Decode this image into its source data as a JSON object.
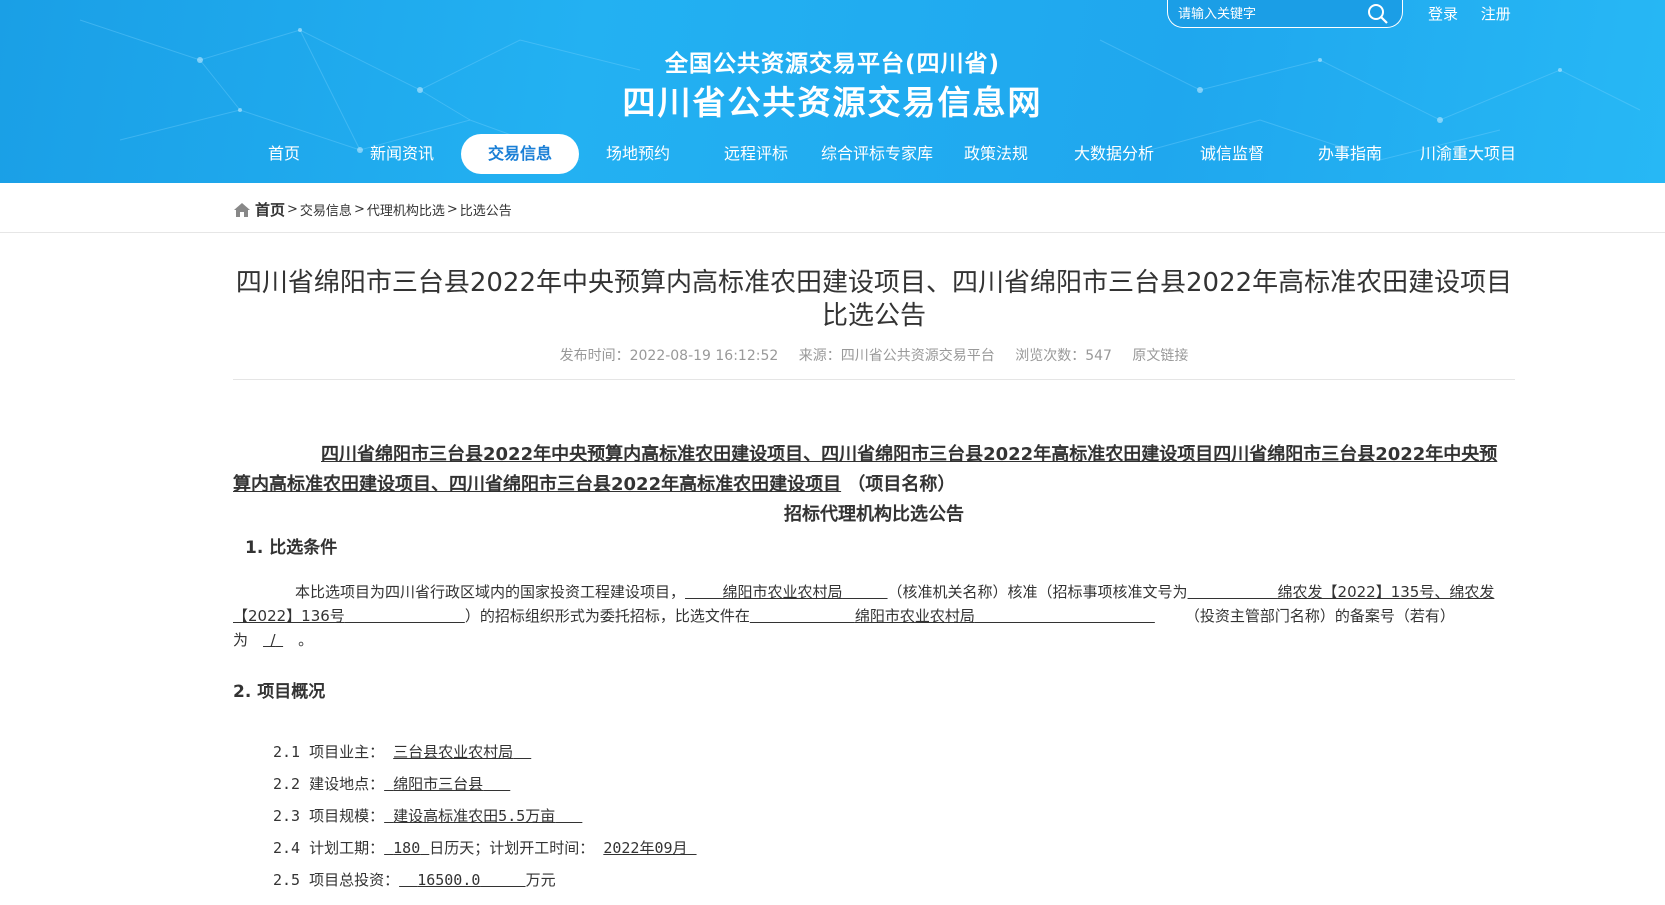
{
  "header": {
    "search_placeholder": "请输入关键字",
    "login": "登录",
    "register": "注册",
    "title1": "全国公共资源交易平台(四川省)",
    "title2": "四川省公共资源交易信息网",
    "nav": [
      "首页",
      "新闻资讯",
      "交易信息",
      "场地预约",
      "远程评标",
      "综合评标专家库",
      "政策法规",
      "大数据分析",
      "诚信监督",
      "办事指南",
      "川渝重大项目"
    ]
  },
  "breadcrumb": {
    "home": "首页",
    "sep": ">",
    "items": [
      "交易信息",
      "代理机构比选",
      "比选公告"
    ]
  },
  "article": {
    "title": "四川省绵阳市三台县2022年中央预算内高标准农田建设项目、四川省绵阳市三台县2022年高标准农田建设项目比选公告",
    "meta": {
      "publish": "发布时间：2022-08-19 16:12:52",
      "source": "来源：四川省公共资源交易平台",
      "views": "浏览次数：547",
      "link": "原文链接"
    },
    "project_heading": "四川省绵阳市三台县2022年中央预算内高标准农田建设项目、四川省绵阳市三台县2022年高标准农田建设项目四川省绵阳市三台县2022年中央预算内高标准农田建设项目、四川省绵阳市三台县2022年高标准农田建设项目",
    "project_suffix": "（项目名称）",
    "subheading": "招标代理机构比选公告",
    "sec1": "1.  比选条件",
    "para1_a": "本比选项目为四川省行政区域内的国家投资工程建设项目，",
    "para1_b": "绵阳市农业农村局",
    "para1_c": "（核准机关名称）核准（招标事项核准文号为",
    "para1_d": "绵农发【2022】135号、绵农发【2022】136号",
    "para1_e": "）的招标组织形式为委托招标，比选文件在",
    "para1_f": "绵阳市农业农村局",
    "para1_g": "（投资主管部门名称）的备案号（若有）为",
    "para1_h": "/",
    "para1_i": "。",
    "sec2": "2.  项目概况",
    "items": [
      {
        "label": "2.1 项目业主：",
        "value": "三台县农业农村局",
        "suffix": ""
      },
      {
        "label": "2.2 建设地点：",
        "value": "绵阳市三台县",
        "suffix": ""
      },
      {
        "label": "2.3 项目规模：",
        "value": "建设高标准农田5.5万亩",
        "suffix": ""
      },
      {
        "label": "2.4 计划工期：",
        "value": "180",
        "suffix": "日历天；计划开工时间：",
        "value2": "2022年09月"
      },
      {
        "label": "2.5 项目总投资：",
        "value": "16500.0",
        "suffix": "万元"
      }
    ]
  }
}
